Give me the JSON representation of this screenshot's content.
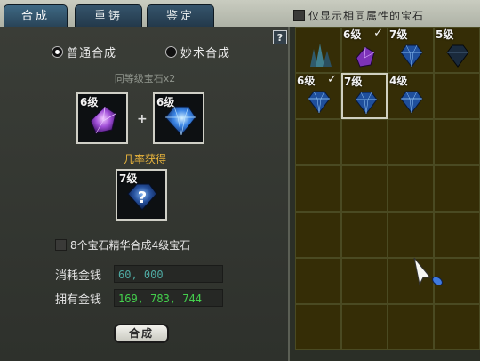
{
  "tabs": [
    "合成",
    "重铸",
    "鉴定"
  ],
  "filter": {
    "label": "仅显示相同属性的宝石",
    "checked": false
  },
  "help": "?",
  "modes": [
    {
      "label": "普通合成",
      "selected": true
    },
    {
      "label": "妙术合成",
      "selected": false
    }
  ],
  "hint": "同等级宝石x2",
  "slots": {
    "a_level": "6级",
    "b_level": "6级",
    "result_level": "7级",
    "plus": "+"
  },
  "chance_text": "几率获得",
  "essence": {
    "label": "8个宝石精华合成4级宝石",
    "checked": false
  },
  "money": {
    "cost_label": "消耗金钱",
    "cost_value": "60, 000",
    "own_label": "拥有金钱",
    "own_value": "169, 783, 744"
  },
  "synth_button": "合成",
  "inventory": [
    {
      "level": "",
      "checked": false,
      "gem": "crystal-cluster"
    },
    {
      "level": "6级",
      "checked": true,
      "gem": "purple-gem"
    },
    {
      "level": "7级",
      "checked": false,
      "gem": "blue-gem"
    },
    {
      "level": "5级",
      "checked": false,
      "gem": "dark-gem"
    },
    {
      "level": "6级",
      "checked": true,
      "gem": "blue-gem"
    },
    {
      "level": "7级",
      "checked": false,
      "gem": "blue-gem",
      "selected": true
    },
    {
      "level": "4级",
      "checked": false,
      "gem": "blue-gem"
    }
  ],
  "colors": {
    "tab_active": "#3e6984",
    "chance": "#e9b43c",
    "cost": "#4ea9a2",
    "own": "#44d04d"
  }
}
